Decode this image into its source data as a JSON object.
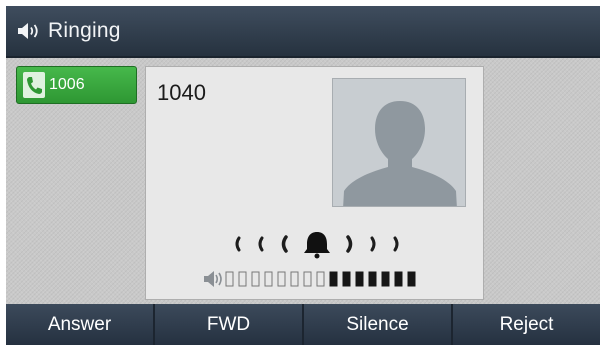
{
  "status": {
    "title": "Ringing",
    "icon": "speaker-icon"
  },
  "line": {
    "label": "1006",
    "icon": "phone-handset-icon",
    "color": "#3aa93f"
  },
  "call": {
    "number": "1040",
    "avatar_icon": "person-silhouette-icon",
    "ringer_icon": "bell-icon",
    "volume": {
      "icon": "speaker-icon",
      "levels_total": 15,
      "level": 7
    }
  },
  "softkeys": [
    "Answer",
    "FWD",
    "Silence",
    "Reject"
  ]
}
